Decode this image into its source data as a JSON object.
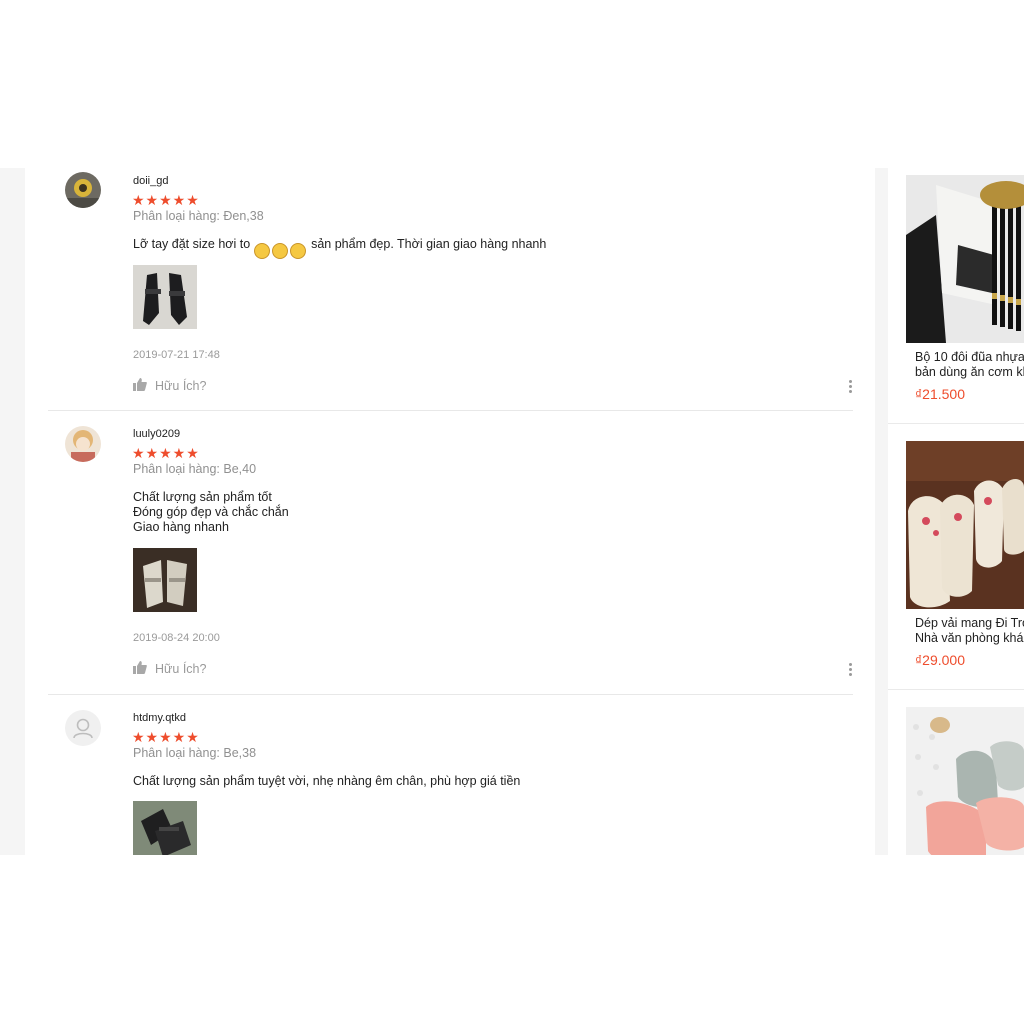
{
  "reviews": [
    {
      "username": "doii_gd",
      "stars": "★★★★★",
      "variant": "Phân loại hàng: Đen,38",
      "content_before": "Lỡ tay đặt size hơi to ",
      "emojis": [
        "😂",
        "😂",
        "😂"
      ],
      "content_after": " sản phẩm đẹp. Thời gian giao hàng nhanh",
      "timestamp": "2019-07-21 17:48",
      "helpful": "Hữu Ích?"
    },
    {
      "username": "luuly0209",
      "stars": "★★★★★",
      "variant": "Phân loại hàng: Be,40",
      "content": "Chất lượng sản phẩm tốt\nĐóng góp đẹp và chắc chắn\nGiao hàng nhanh",
      "timestamp": "2019-08-24 20:00",
      "helpful": "Hữu Ích?"
    },
    {
      "username": "htdmy.qtkd",
      "stars": "★★★★★",
      "variant": "Phân loại hàng: Be,38",
      "content": "Chất lượng sản phẩm tuyệt vời, nhẹ nhàng êm chân, phù hợp giá tiền"
    }
  ],
  "sidebar": {
    "products": [
      {
        "title_line1": "Bộ 10 đôi đũa nhựa",
        "title_line2": "bản dùng ăn cơm kh",
        "price": "₫21.500"
      },
      {
        "title_line1": "Dép vải mang Đi Tro",
        "title_line2": "Nhà văn phòng khá",
        "price": "₫29.000"
      }
    ]
  },
  "colors": {
    "accent": "#ee4d2d",
    "muted": "#909090",
    "band": "#f5f5f5"
  },
  "icons": [
    "thumbs-up-icon",
    "more-vertical-icon",
    "default-avatar-icon",
    "star-icon"
  ]
}
